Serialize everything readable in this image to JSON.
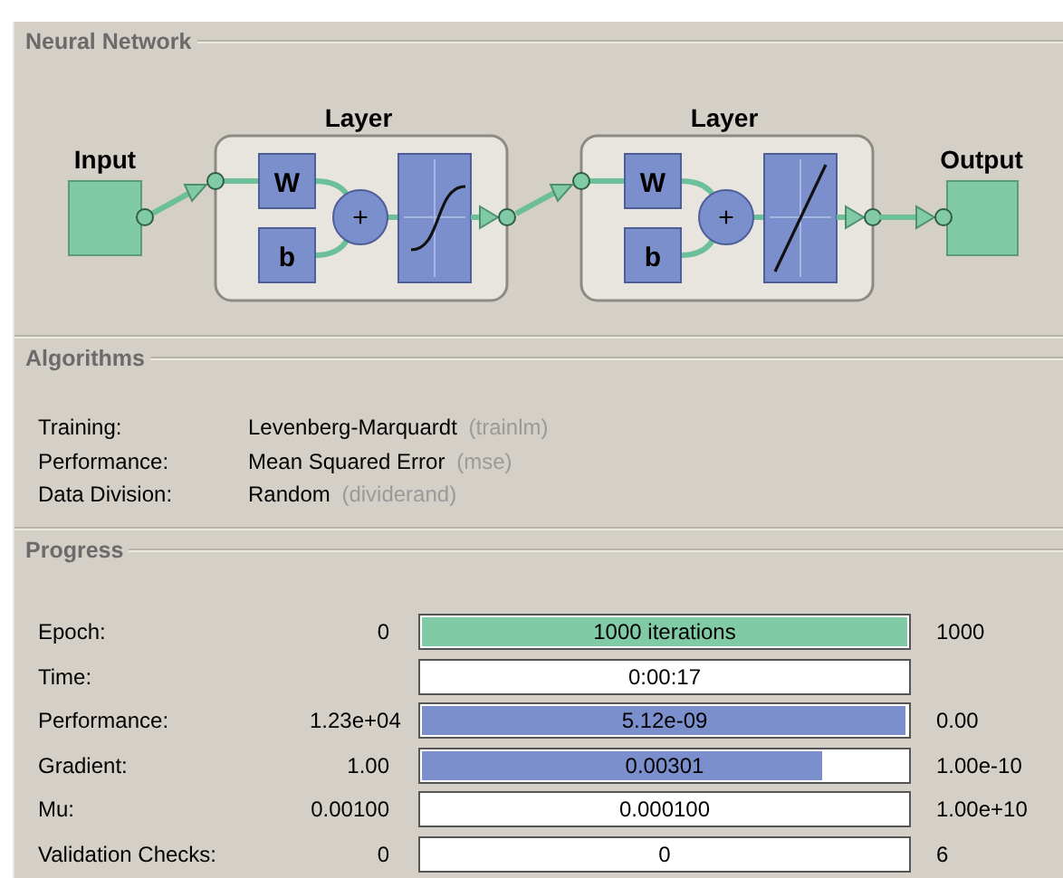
{
  "network": {
    "title": "Neural Network",
    "input_label": "Input",
    "output_label": "Output",
    "layers": [
      {
        "title": "Layer",
        "weight_label": "W",
        "bias_label": "b",
        "sum_label": "+",
        "kind": "sigmoid"
      },
      {
        "title": "Layer",
        "weight_label": "W",
        "bias_label": "b",
        "sum_label": "+",
        "kind": "linear"
      }
    ]
  },
  "algorithms": {
    "title": "Algorithms",
    "rows": [
      {
        "label": "Training:",
        "value": "Levenberg-Marquardt",
        "code": "(trainlm)"
      },
      {
        "label": "Performance:",
        "value": "Mean Squared Error",
        "code": "(mse)"
      },
      {
        "label": "Data Division:",
        "value": "Random",
        "code": "(dividerand)"
      }
    ]
  },
  "progress": {
    "title": "Progress",
    "rows": [
      {
        "label": "Epoch:",
        "start": "0",
        "reading": "1000 iterations",
        "end": "1000",
        "level": 1,
        "color": "#80cba6"
      },
      {
        "label": "Time:",
        "reading": "0:00:17"
      },
      {
        "label": "Performance:",
        "start": "1.23e+04",
        "reading": "5.12e-09",
        "end": "0.00",
        "level": 0.99,
        "color": "#7b8fcc"
      },
      {
        "label": "Gradient:",
        "start": "1.00",
        "reading": "0.00301",
        "end": "1.00e-10",
        "level": 0.82,
        "color": "#7b8fcc"
      },
      {
        "label": "Mu:",
        "start": "0.00100",
        "reading": "0.000100",
        "end": "1.00e+10"
      },
      {
        "label": "Validation Checks:",
        "start": "0",
        "reading": "0",
        "end": "6"
      }
    ]
  }
}
